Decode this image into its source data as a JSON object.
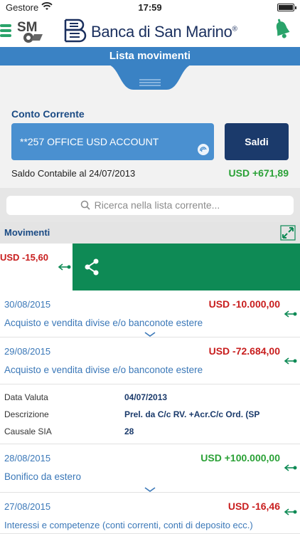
{
  "status_bar": {
    "carrier": "Gestore",
    "time": "17:59"
  },
  "header": {
    "bank_name": "Banca di San Marino",
    "logo_text": "SM",
    "registered_mark": "®"
  },
  "title_bar": {
    "title": "Lista movimenti"
  },
  "account": {
    "label": "Conto Corrente",
    "selected": "**257 OFFICE USD ACCOUNT",
    "saldi_button": "Saldi",
    "balance_label": "Saldo Contabile al 24/07/2013",
    "balance_amount": "USD +671,89"
  },
  "search": {
    "placeholder": "Ricerca nella lista corrente..."
  },
  "movements_section": {
    "title": "Movimenti"
  },
  "swiped_row": {
    "amount": "USD -15,60"
  },
  "movements": [
    {
      "date": "30/08/2015",
      "amount": "USD -10.000,00",
      "description": "Acquisto e vendita divise e/o banconote estere"
    },
    {
      "date": "29/08/2015",
      "amount": "USD -72.684,00",
      "description": "Acquisto e vendita divise e/o banconote estere"
    },
    {
      "date": "28/08/2015",
      "amount": "USD +100.000,00",
      "description": "Bonifico da estero"
    },
    {
      "date": "27/08/2015",
      "amount": "USD -16,46",
      "description": "Interessi e competenze (conti correnti, conti di deposito ecc.)"
    }
  ],
  "details": {
    "data_valuta_label": "Data Valuta",
    "data_valuta_value": "04/07/2013",
    "descrizione_label": "Descrizione",
    "descrizione_value": "Prel. da C/c RV. +Acr.C/c Ord. (SP",
    "causale_label": "Causale SIA",
    "causale_value": "28"
  },
  "colors": {
    "primary_blue": "#3a82c4",
    "dark_blue": "#1b3a6b",
    "action_green": "#0e8a55",
    "positive_green": "#2aa136",
    "negative_red": "#c81e1e"
  },
  "icons": [
    "menu-icon",
    "wifi-icon",
    "battery-icon",
    "bell-icon",
    "search-icon",
    "expand-icon",
    "share-icon",
    "swipe-arrow-icon",
    "chevron-down-icon",
    "fingerprint-icon"
  ]
}
